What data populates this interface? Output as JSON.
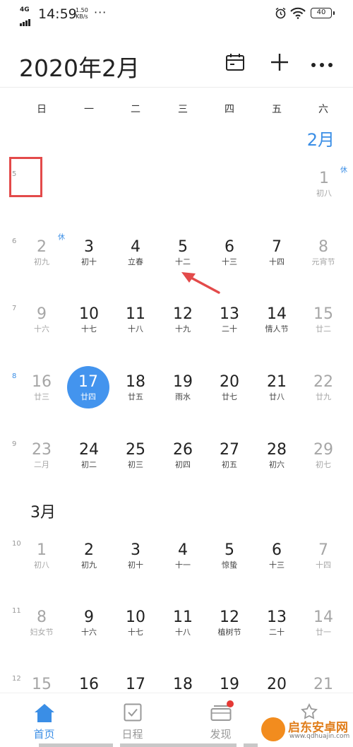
{
  "status_bar": {
    "network": "4G",
    "time": "14:59",
    "speed_value": "1.50",
    "speed_unit": "KB/s",
    "more": "···",
    "battery": "40"
  },
  "header": {
    "title": "2020年2月",
    "calendar_icon": "calendar-icon",
    "add_icon": "plus-icon",
    "more_icon": "more-icon"
  },
  "weekdays": [
    "日",
    "一",
    "二",
    "三",
    "四",
    "五",
    "六"
  ],
  "feb_label": "2月",
  "mar_label": "3月",
  "rest_label": "休",
  "week_numbers": [
    "5",
    "6",
    "7",
    "8",
    "9",
    "10",
    "11",
    "12"
  ],
  "weeks": [
    [
      {
        "num": "1",
        "lunar": "初八"
      }
    ],
    [
      {
        "num": "2",
        "lunar": "初九"
      },
      {
        "num": "3",
        "lunar": "初十"
      },
      {
        "num": "4",
        "lunar": "立春"
      },
      {
        "num": "5",
        "lunar": "十二"
      },
      {
        "num": "6",
        "lunar": "十三"
      },
      {
        "num": "7",
        "lunar": "十四"
      },
      {
        "num": "8",
        "lunar": "元宵节"
      }
    ],
    [
      {
        "num": "9",
        "lunar": "十六"
      },
      {
        "num": "10",
        "lunar": "十七"
      },
      {
        "num": "11",
        "lunar": "十八"
      },
      {
        "num": "12",
        "lunar": "十九"
      },
      {
        "num": "13",
        "lunar": "二十"
      },
      {
        "num": "14",
        "lunar": "情人节"
      },
      {
        "num": "15",
        "lunar": "廿二"
      }
    ],
    [
      {
        "num": "16",
        "lunar": "廿三"
      },
      {
        "num": "17",
        "lunar": "廿四"
      },
      {
        "num": "18",
        "lunar": "廿五"
      },
      {
        "num": "19",
        "lunar": "雨水"
      },
      {
        "num": "20",
        "lunar": "廿七"
      },
      {
        "num": "21",
        "lunar": "廿八"
      },
      {
        "num": "22",
        "lunar": "廿九"
      }
    ],
    [
      {
        "num": "23",
        "lunar": "二月"
      },
      {
        "num": "24",
        "lunar": "初二"
      },
      {
        "num": "25",
        "lunar": "初三"
      },
      {
        "num": "26",
        "lunar": "初四"
      },
      {
        "num": "27",
        "lunar": "初五"
      },
      {
        "num": "28",
        "lunar": "初六"
      },
      {
        "num": "29",
        "lunar": "初七"
      }
    ],
    [
      {
        "num": "1",
        "lunar": "初八"
      },
      {
        "num": "2",
        "lunar": "初九"
      },
      {
        "num": "3",
        "lunar": "初十"
      },
      {
        "num": "4",
        "lunar": "十一"
      },
      {
        "num": "5",
        "lunar": "惊蛰"
      },
      {
        "num": "6",
        "lunar": "十三"
      },
      {
        "num": "7",
        "lunar": "十四"
      }
    ],
    [
      {
        "num": "8",
        "lunar": "妇女节"
      },
      {
        "num": "9",
        "lunar": "十六"
      },
      {
        "num": "10",
        "lunar": "十七"
      },
      {
        "num": "11",
        "lunar": "十八"
      },
      {
        "num": "12",
        "lunar": "植树节"
      },
      {
        "num": "13",
        "lunar": "二十"
      },
      {
        "num": "14",
        "lunar": "廿一"
      }
    ],
    [
      {
        "num": "15",
        "lunar": ""
      },
      {
        "num": "16",
        "lunar": ""
      },
      {
        "num": "17",
        "lunar": ""
      },
      {
        "num": "18",
        "lunar": ""
      },
      {
        "num": "19",
        "lunar": ""
      },
      {
        "num": "20",
        "lunar": ""
      },
      {
        "num": "21",
        "lunar": ""
      }
    ]
  ],
  "bottom_nav": {
    "items": [
      {
        "label": "首页",
        "icon": "home-icon"
      },
      {
        "label": "日程",
        "icon": "checkbox-icon"
      },
      {
        "label": "发现",
        "icon": "discover-icon"
      },
      {
        "label": "",
        "icon": "profile-icon"
      }
    ]
  },
  "watermark": {
    "title": "启东安卓网",
    "url": "www.qdhuajin.com"
  },
  "colors": {
    "accent": "#4394ee",
    "annotation_red": "#e34a4a",
    "weekend_gray": "#a6a6a6"
  }
}
